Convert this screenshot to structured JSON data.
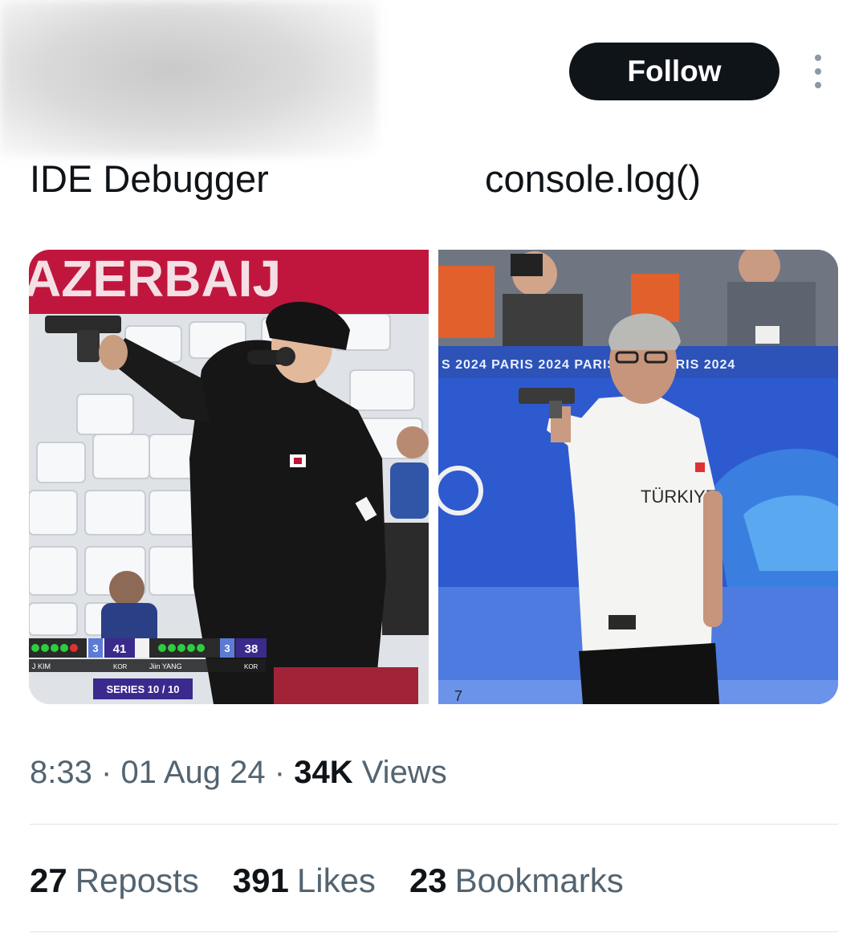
{
  "header": {
    "follow_label": "Follow"
  },
  "post": {
    "caption_left": "IDE Debugger",
    "caption_right": "console.log()"
  },
  "media": {
    "left_photo": {
      "banner_text": "AZERBAIJ",
      "scoreboard": {
        "player1_name": "J KIM",
        "player1_sets": "3",
        "player1_total": "41",
        "player1_country": "KOR",
        "player2_name": "Jiin YANG",
        "player2_sets": "3",
        "player2_total": "38",
        "player2_country": "KOR",
        "series": "SERIES 10 / 10"
      }
    },
    "right_photo": {
      "board_text": "S 2024   PARIS 2024   PARIS 2024   PARIS 2024",
      "shirt_text": "TÜRKIYE",
      "lane_number": "7"
    }
  },
  "meta": {
    "time": "8:33",
    "date": "01 Aug 24",
    "separator": "·",
    "views_count": "34K",
    "views_label": "Views"
  },
  "stats": {
    "reposts_count": "27",
    "reposts_label": "Reposts",
    "likes_count": "391",
    "likes_label": "Likes",
    "bookmarks_count": "23",
    "bookmarks_label": "Bookmarks"
  },
  "colors": {
    "text_primary": "#0f1419",
    "text_secondary": "#536471",
    "follow_bg": "#0f1419"
  }
}
